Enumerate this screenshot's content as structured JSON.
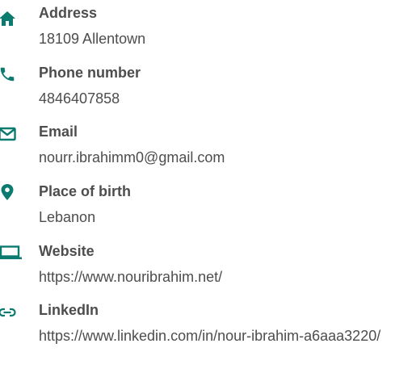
{
  "accent_color": "#0b7a6f",
  "text_color": "#4d4d4d",
  "items": [
    {
      "icon": "home-icon",
      "label": "Address",
      "value": "18109 Allentown"
    },
    {
      "icon": "phone-icon",
      "label": "Phone number",
      "value": "4846407858"
    },
    {
      "icon": "envelope-icon",
      "label": "Email",
      "value": "nourr.ibrahimm0@gmail.com"
    },
    {
      "icon": "map-pin-icon",
      "label": "Place of birth",
      "value": "Lebanon"
    },
    {
      "icon": "laptop-icon",
      "label": "Website",
      "value": "https://www.nouribrahim.net/"
    },
    {
      "icon": "link-icon",
      "label": "LinkedIn",
      "value": "https://www.linkedin.com/in/nour-ibrahim-a6aaa3220/"
    }
  ]
}
